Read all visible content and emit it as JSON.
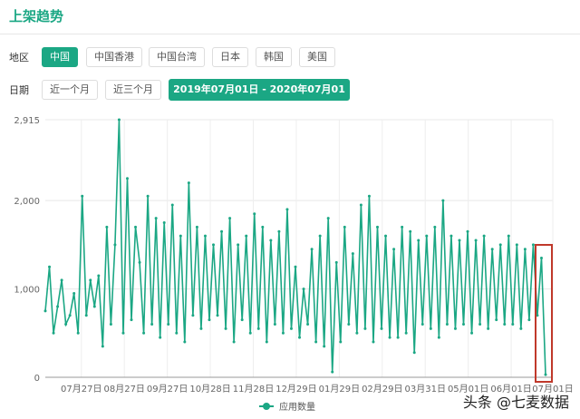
{
  "header": {
    "title": "上架趋势"
  },
  "filters": {
    "region_label": "地区",
    "regions": [
      "中国",
      "中国香港",
      "中国台湾",
      "日本",
      "韩国",
      "美国"
    ],
    "date_label": "日期",
    "date_buttons": [
      "近一个月",
      "近三个月"
    ],
    "date_range": "2019年07月01日 - 2020年07月01日 ▾"
  },
  "watermark": "头条 @七麦数据",
  "chart_data": {
    "type": "line",
    "title": "",
    "legend": [
      "应用数量"
    ],
    "legend_position": "bottom",
    "color": "#1ba784",
    "y_ticks": [
      "0",
      "1,000",
      "2,000",
      "2,915"
    ],
    "ylim": [
      0,
      2915
    ],
    "x_ticks": [
      "07月27日",
      "08月27日",
      "09月27日",
      "10月28日",
      "11月28日",
      "12月29日",
      "01月29日",
      "02月29日",
      "03月31日",
      "05月01日",
      "06月01日",
      "07月01日"
    ],
    "x_range": [
      "2019-07-01",
      "2020-07-01"
    ],
    "series": [
      {
        "name": "应用数量",
        "values": [
          750,
          1250,
          500,
          800,
          1100,
          600,
          700,
          950,
          500,
          2050,
          700,
          1100,
          800,
          1150,
          350,
          1700,
          600,
          1500,
          2915,
          500,
          2250,
          650,
          1700,
          1300,
          500,
          2050,
          600,
          1800,
          450,
          1750,
          600,
          1950,
          500,
          1600,
          400,
          2200,
          700,
          1700,
          550,
          1600,
          650,
          1500,
          700,
          1650,
          550,
          1800,
          400,
          1500,
          650,
          1600,
          500,
          1850,
          550,
          1700,
          400,
          1550,
          600,
          1650,
          500,
          1900,
          550,
          1250,
          450,
          1000,
          600,
          1450,
          400,
          1600,
          350,
          1800,
          60,
          1300,
          400,
          1700,
          600,
          1400,
          500,
          1950,
          550,
          2050,
          400,
          1700,
          550,
          1600,
          450,
          1450,
          450,
          1700,
          500,
          1650,
          280,
          1550,
          600,
          1600,
          550,
          1700,
          450,
          2000,
          600,
          1600,
          550,
          1550,
          600,
          1650,
          500,
          1550,
          600,
          1600,
          550,
          1450,
          650,
          1500,
          600,
          1600,
          600,
          1500,
          550,
          1450,
          650,
          1500,
          700,
          1350,
          30
        ]
      }
    ]
  }
}
